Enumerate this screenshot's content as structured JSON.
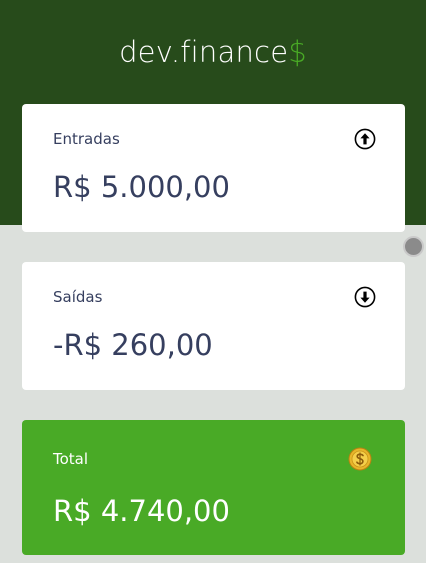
{
  "header": {
    "logo_text": "dev.finance",
    "logo_accent": "$"
  },
  "cards": {
    "income": {
      "label": "Entradas",
      "amount": "R$ 5.000,00",
      "icon": "arrow-up-circle-icon"
    },
    "expense": {
      "label": "Saídas",
      "amount": "-R$ 260,00",
      "icon": "arrow-down-circle-icon"
    },
    "total": {
      "label": "Total",
      "amount": "R$ 4.740,00",
      "icon": "dollar-coin-icon"
    }
  },
  "colors": {
    "header_bg": "#274b1b",
    "accent": "#49aa26",
    "page_bg": "#dce0dc",
    "text_dark": "#363f5f"
  }
}
